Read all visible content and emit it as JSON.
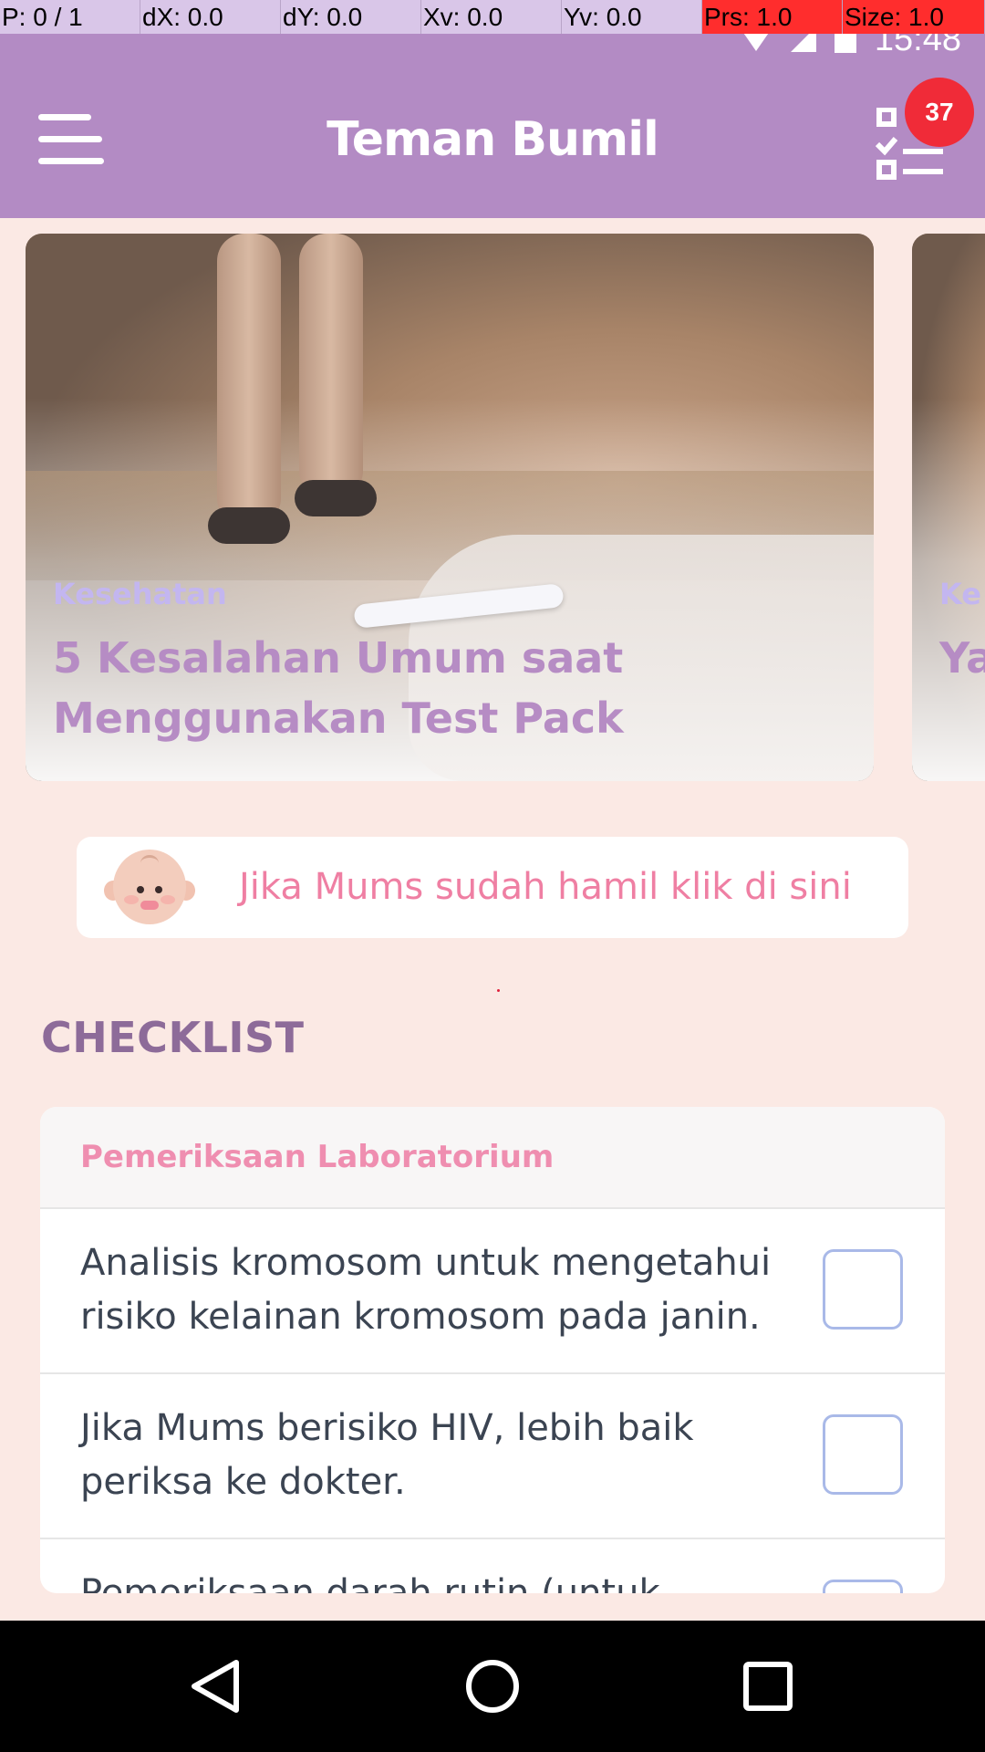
{
  "debug_overlay": {
    "pointer": "P: 0 / 1",
    "dx": "dX: 0.0",
    "dy": "dY: 0.0",
    "xv": "Xv: 0.0",
    "yv": "Yv: 0.0",
    "pressure": "Prs: 1.0",
    "size": "Size: 1.0"
  },
  "status_bar": {
    "time": "15:48",
    "icons": [
      "wifi-icon",
      "signal-icon",
      "battery-icon"
    ]
  },
  "app_bar": {
    "title": "Teman Bumil",
    "notification_count": "37",
    "colors": {
      "primary": "#b38bc4",
      "badge": "#f02b38"
    }
  },
  "articles": [
    {
      "category": "Kesehatan",
      "title": "5 Kesalahan Umum saat Menggunakan Test Pack"
    },
    {
      "category": "Ke",
      "title": "Ya Se"
    }
  ],
  "pregnant_banner": {
    "text": "Jika Mums sudah hamil klik di sini"
  },
  "checklist": {
    "section_title": "CHECKLIST",
    "group_title": "Pemeriksaan Laboratorium",
    "items": [
      {
        "text": "Analisis kromosom untuk mengetahui risiko kelainan kromosom pada janin.",
        "checked": false
      },
      {
        "text": "Jika Mums berisiko HIV, lebih baik periksa ke dokter.",
        "checked": false
      },
      {
        "text": "Pemeriksaan darah rutin (untuk",
        "checked": false
      }
    ]
  },
  "nav_bar": {
    "buttons": [
      "back-icon",
      "home-icon",
      "recent-apps-icon"
    ]
  }
}
